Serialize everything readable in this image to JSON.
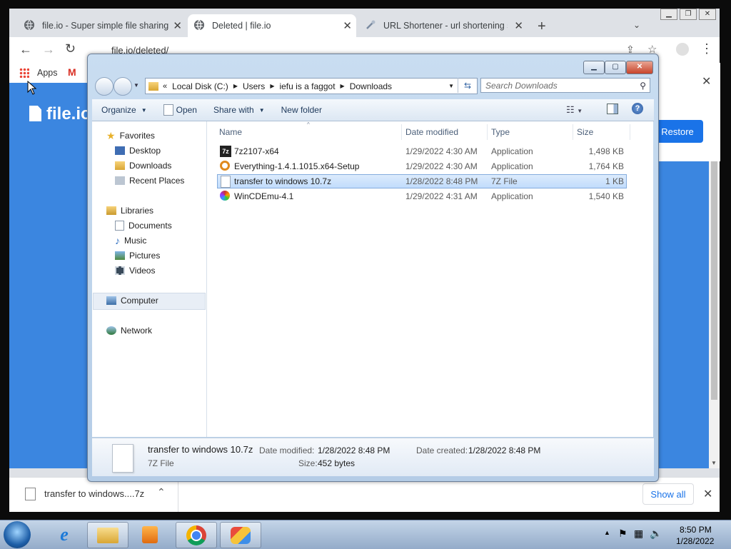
{
  "browser": {
    "tabs": [
      {
        "label": "file.io - Super simple file sharing",
        "icon": "globe-icon",
        "active": false
      },
      {
        "label": "Deleted | file.io",
        "icon": "globe-icon",
        "active": true
      },
      {
        "label": "URL Shortener - url shortening se",
        "icon": "link-icon",
        "active": false
      }
    ],
    "url": "file.io/deleted/",
    "bookmarks": {
      "apps_label": "Apps",
      "gmail_label": "M"
    },
    "page_logo": "file.io",
    "restore_label": "Restore",
    "download": {
      "filename": "transfer to windows....7z",
      "show_all": "Show all"
    }
  },
  "explorer": {
    "breadcrumb": [
      "Local Disk (C:)",
      "Users",
      "iefu is a faggot",
      "Downloads"
    ],
    "search_placeholder": "Search Downloads",
    "commands": {
      "organize": "Organize",
      "open": "Open",
      "share_with": "Share with",
      "new_folder": "New folder"
    },
    "nav": {
      "favorites": "Favorites",
      "favorites_items": [
        "Desktop",
        "Downloads",
        "Recent Places"
      ],
      "libraries": "Libraries",
      "libraries_items": [
        "Documents",
        "Music",
        "Pictures",
        "Videos"
      ],
      "computer": "Computer",
      "network": "Network"
    },
    "columns": {
      "name": "Name",
      "date": "Date modified",
      "type": "Type",
      "size": "Size"
    },
    "files": [
      {
        "name": "7z2107-x64",
        "date": "1/29/2022 4:30 AM",
        "type": "Application",
        "size": "1,498 KB",
        "icon": "7zip-icon"
      },
      {
        "name": "Everything-1.4.1.1015.x64-Setup",
        "date": "1/29/2022 4:30 AM",
        "type": "Application",
        "size": "1,764 KB",
        "icon": "magnifier-icon"
      },
      {
        "name": "transfer to windows 10.7z",
        "date": "1/28/2022 8:48 PM",
        "type": "7Z File",
        "size": "1 KB",
        "icon": "file-icon",
        "selected": true
      },
      {
        "name": "WinCDEmu-4.1",
        "date": "1/29/2022 4:31 AM",
        "type": "Application",
        "size": "1,540 KB",
        "icon": "cd-icon"
      }
    ],
    "details": {
      "name": "transfer to windows 10.7z",
      "type": "7Z File",
      "date_modified_label": "Date modified:",
      "date_modified": "1/28/2022 8:48 PM",
      "date_created_label": "Date created:",
      "date_created": "1/28/2022 8:48 PM",
      "size_label": "Size:",
      "size": "452 bytes"
    }
  },
  "taskbar": {
    "time": "8:50 PM",
    "date": "1/28/2022"
  }
}
